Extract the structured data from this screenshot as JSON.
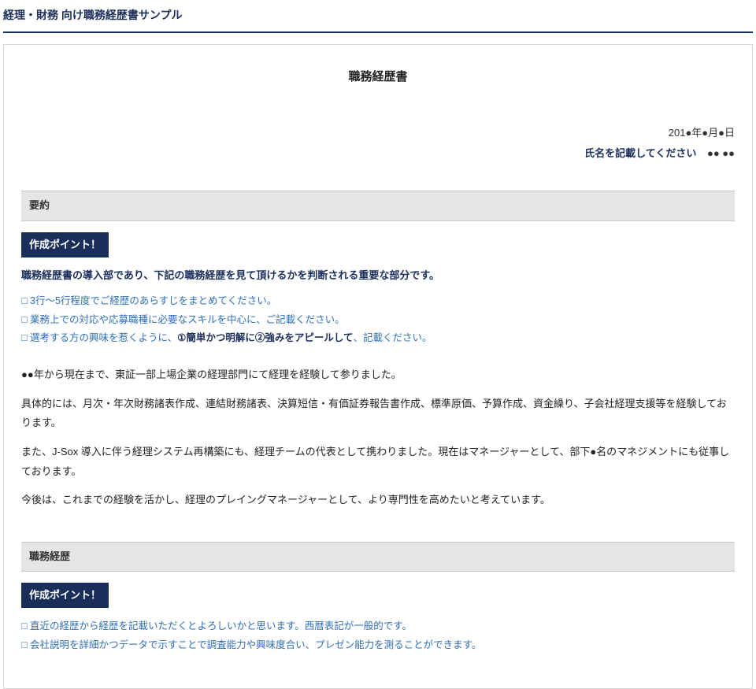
{
  "page_header": "経理・財務 向け職務経歴書サンプル",
  "doc_title": "職務経歴書",
  "meta": {
    "date": "201●年●月●日",
    "name_label": "氏名を記載してください",
    "name_value": "●● ●●"
  },
  "section_summary": {
    "bar": "要約",
    "point_badge": "作成ポイント！",
    "lead": "職務経歴書の導入部であり、下記の職務経歴を見て頂けるかを判断される重要な部分です。",
    "checks": {
      "c1": "3行～5行程度でご経歴のあらすじをまとめてください。",
      "c2": "業務上での対応や応募職種に必要なスキルを中心に、ご記載ください。",
      "c3_a": "選考する方の興味を惹くように、",
      "c3_b": "①簡単かつ明解に②強みをアピールして",
      "c3_c": "、記載ください。"
    },
    "body": {
      "p1": "●●年から現在まで、東証一部上場企業の経理部門にて経理を経験して参りました。",
      "p2": "具体的には、月次・年次財務諸表作成、連結財務諸表、決算短信・有価証券報告書作成、標準原価、予算作成、資金繰り、子会社経理支援等を経験しております。",
      "p3": "また、J-Sox 導入に伴う経理システム再構築にも、経理チームの代表として携わりました。現在はマネージャーとして、部下●名のマネジメントにも従事しております。",
      "p4": "今後は、これまでの経験を活かし、経理のプレイングマネージャーとして、より専門性を高めたいと考えています。"
    }
  },
  "section_history": {
    "bar": "職務経歴",
    "point_badge": "作成ポイント！",
    "checks": {
      "c1": "直近の経歴から経歴を記載いただくとよろしいかと思います。西暦表記が一般的です。",
      "c2": "会社説明を詳細かつデータで示すことで調査能力や興味度合い、プレゼン能力を測ることができます。"
    }
  }
}
